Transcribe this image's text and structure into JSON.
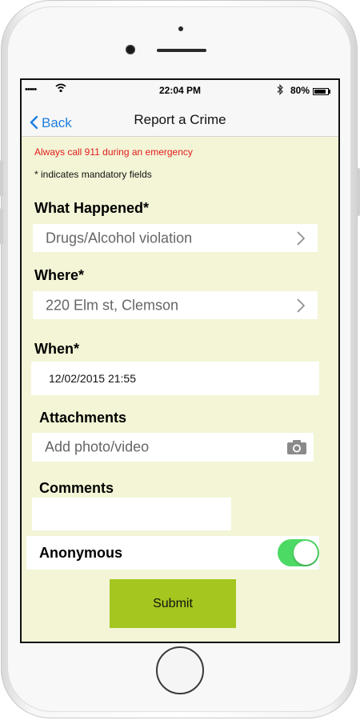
{
  "status_bar": {
    "signal": "•••••",
    "time": "22:04 PM",
    "battery": "80%"
  },
  "nav": {
    "back_label": "Back",
    "title": "Report a Crime"
  },
  "notice": {
    "emergency": "Always call 911 during an emergency",
    "mandatory": "* indicates mandatory fields"
  },
  "form": {
    "what_label": "What Happened*",
    "what_value": "Drugs/Alcohol violation",
    "where_label": "Where*",
    "where_value": "220 Elm st, Clemson",
    "when_label": "When*",
    "when_value": "12/02/2015 21:55",
    "attachments_label": "Attachments",
    "attachments_placeholder": "Add photo/video",
    "comments_label": "Comments",
    "comments_value": "",
    "anonymous_label": "Anonymous",
    "anonymous_on": true
  },
  "submit_label": "Submit",
  "colors": {
    "background": "#f3f5d6",
    "accent": "#1e7ee0",
    "warning": "#e21c1c",
    "toggle_on": "#4cd964",
    "submit": "#a4c61f"
  },
  "icons": [
    "wifi-icon",
    "bluetooth-icon",
    "battery-icon",
    "chevron-left-icon",
    "chevron-right-icon",
    "camera-icon"
  ]
}
